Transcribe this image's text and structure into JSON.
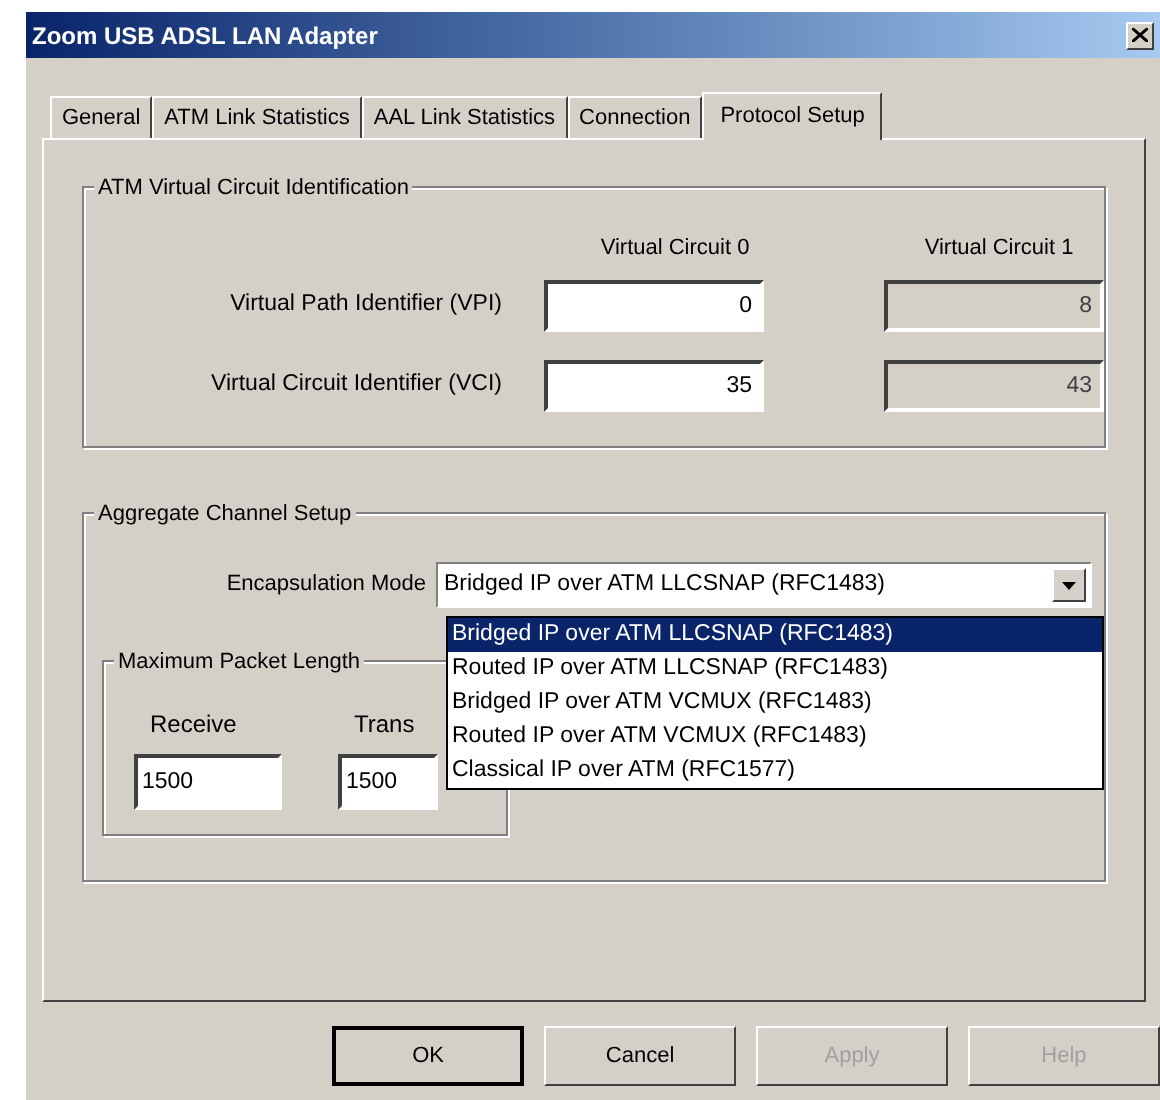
{
  "window": {
    "title": "Zoom USB ADSL LAN Adapter"
  },
  "tabs": [
    {
      "label": "General",
      "selected": false
    },
    {
      "label": "ATM Link Statistics",
      "selected": false
    },
    {
      "label": "AAL Link Statistics",
      "selected": false
    },
    {
      "label": "Connection",
      "selected": false
    },
    {
      "label": "Protocol Setup",
      "selected": true
    }
  ],
  "circuit_group": {
    "title": "ATM Virtual Circuit Identification",
    "columns": [
      "Virtual Circuit 0",
      "Virtual Circuit 1"
    ],
    "rows": [
      {
        "label": "Virtual Path Identifier (VPI)",
        "fields": [
          {
            "value": "0",
            "disabled": false
          },
          {
            "value": "8",
            "disabled": true
          }
        ]
      },
      {
        "label": "Virtual Circuit Identifier (VCI)",
        "fields": [
          {
            "value": "35",
            "disabled": false
          },
          {
            "value": "43",
            "disabled": true
          }
        ]
      }
    ]
  },
  "channel_group": {
    "title": "Aggregate Channel Setup",
    "encapsulation": {
      "label": "Encapsulation Mode",
      "value": "Bridged IP over ATM LLCSNAP (RFC1483)",
      "expanded": true,
      "options": [
        {
          "label": "Bridged IP over ATM LLCSNAP (RFC1483)",
          "selected": true
        },
        {
          "label": "Routed IP over ATM LLCSNAP (RFC1483)",
          "selected": false
        },
        {
          "label": "Bridged IP over ATM VCMUX (RFC1483)",
          "selected": false
        },
        {
          "label": "Routed IP over ATM VCMUX (RFC1483)",
          "selected": false
        },
        {
          "label": "Classical IP over ATM (RFC1577)",
          "selected": false
        }
      ]
    },
    "packet_group": {
      "title": "Maximum Packet Length",
      "fields": [
        {
          "label": "Receive",
          "value": "1500"
        },
        {
          "label": "Trans",
          "value": "1500"
        }
      ]
    }
  },
  "buttons": [
    {
      "label": "OK",
      "disabled": false,
      "default": true
    },
    {
      "label": "Cancel",
      "disabled": false,
      "default": false
    },
    {
      "label": "Apply",
      "disabled": true,
      "default": false
    },
    {
      "label": "Help",
      "disabled": true,
      "default": false
    }
  ]
}
